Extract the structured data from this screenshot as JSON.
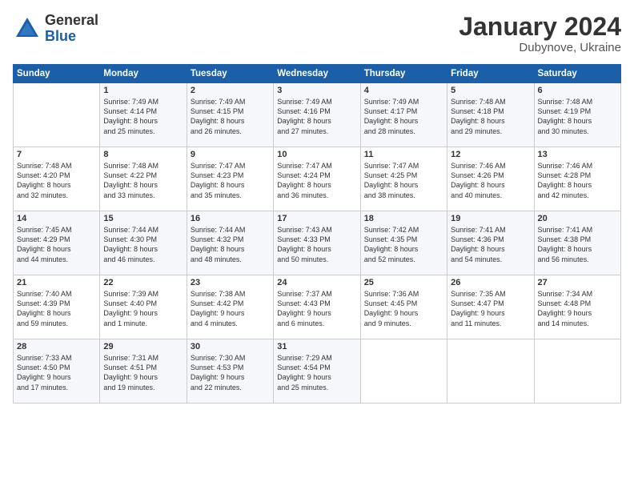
{
  "header": {
    "logo_general": "General",
    "logo_blue": "Blue",
    "month_title": "January 2024",
    "location": "Dubynove, Ukraine"
  },
  "weekdays": [
    "Sunday",
    "Monday",
    "Tuesday",
    "Wednesday",
    "Thursday",
    "Friday",
    "Saturday"
  ],
  "weeks": [
    [
      {
        "day": "",
        "info": ""
      },
      {
        "day": "1",
        "info": "Sunrise: 7:49 AM\nSunset: 4:14 PM\nDaylight: 8 hours\nand 25 minutes."
      },
      {
        "day": "2",
        "info": "Sunrise: 7:49 AM\nSunset: 4:15 PM\nDaylight: 8 hours\nand 26 minutes."
      },
      {
        "day": "3",
        "info": "Sunrise: 7:49 AM\nSunset: 4:16 PM\nDaylight: 8 hours\nand 27 minutes."
      },
      {
        "day": "4",
        "info": "Sunrise: 7:49 AM\nSunset: 4:17 PM\nDaylight: 8 hours\nand 28 minutes."
      },
      {
        "day": "5",
        "info": "Sunrise: 7:48 AM\nSunset: 4:18 PM\nDaylight: 8 hours\nand 29 minutes."
      },
      {
        "day": "6",
        "info": "Sunrise: 7:48 AM\nSunset: 4:19 PM\nDaylight: 8 hours\nand 30 minutes."
      }
    ],
    [
      {
        "day": "7",
        "info": "Sunrise: 7:48 AM\nSunset: 4:20 PM\nDaylight: 8 hours\nand 32 minutes."
      },
      {
        "day": "8",
        "info": "Sunrise: 7:48 AM\nSunset: 4:22 PM\nDaylight: 8 hours\nand 33 minutes."
      },
      {
        "day": "9",
        "info": "Sunrise: 7:47 AM\nSunset: 4:23 PM\nDaylight: 8 hours\nand 35 minutes."
      },
      {
        "day": "10",
        "info": "Sunrise: 7:47 AM\nSunset: 4:24 PM\nDaylight: 8 hours\nand 36 minutes."
      },
      {
        "day": "11",
        "info": "Sunrise: 7:47 AM\nSunset: 4:25 PM\nDaylight: 8 hours\nand 38 minutes."
      },
      {
        "day": "12",
        "info": "Sunrise: 7:46 AM\nSunset: 4:26 PM\nDaylight: 8 hours\nand 40 minutes."
      },
      {
        "day": "13",
        "info": "Sunrise: 7:46 AM\nSunset: 4:28 PM\nDaylight: 8 hours\nand 42 minutes."
      }
    ],
    [
      {
        "day": "14",
        "info": "Sunrise: 7:45 AM\nSunset: 4:29 PM\nDaylight: 8 hours\nand 44 minutes."
      },
      {
        "day": "15",
        "info": "Sunrise: 7:44 AM\nSunset: 4:30 PM\nDaylight: 8 hours\nand 46 minutes."
      },
      {
        "day": "16",
        "info": "Sunrise: 7:44 AM\nSunset: 4:32 PM\nDaylight: 8 hours\nand 48 minutes."
      },
      {
        "day": "17",
        "info": "Sunrise: 7:43 AM\nSunset: 4:33 PM\nDaylight: 8 hours\nand 50 minutes."
      },
      {
        "day": "18",
        "info": "Sunrise: 7:42 AM\nSunset: 4:35 PM\nDaylight: 8 hours\nand 52 minutes."
      },
      {
        "day": "19",
        "info": "Sunrise: 7:41 AM\nSunset: 4:36 PM\nDaylight: 8 hours\nand 54 minutes."
      },
      {
        "day": "20",
        "info": "Sunrise: 7:41 AM\nSunset: 4:38 PM\nDaylight: 8 hours\nand 56 minutes."
      }
    ],
    [
      {
        "day": "21",
        "info": "Sunrise: 7:40 AM\nSunset: 4:39 PM\nDaylight: 8 hours\nand 59 minutes."
      },
      {
        "day": "22",
        "info": "Sunrise: 7:39 AM\nSunset: 4:40 PM\nDaylight: 9 hours\nand 1 minute."
      },
      {
        "day": "23",
        "info": "Sunrise: 7:38 AM\nSunset: 4:42 PM\nDaylight: 9 hours\nand 4 minutes."
      },
      {
        "day": "24",
        "info": "Sunrise: 7:37 AM\nSunset: 4:43 PM\nDaylight: 9 hours\nand 6 minutes."
      },
      {
        "day": "25",
        "info": "Sunrise: 7:36 AM\nSunset: 4:45 PM\nDaylight: 9 hours\nand 9 minutes."
      },
      {
        "day": "26",
        "info": "Sunrise: 7:35 AM\nSunset: 4:47 PM\nDaylight: 9 hours\nand 11 minutes."
      },
      {
        "day": "27",
        "info": "Sunrise: 7:34 AM\nSunset: 4:48 PM\nDaylight: 9 hours\nand 14 minutes."
      }
    ],
    [
      {
        "day": "28",
        "info": "Sunrise: 7:33 AM\nSunset: 4:50 PM\nDaylight: 9 hours\nand 17 minutes."
      },
      {
        "day": "29",
        "info": "Sunrise: 7:31 AM\nSunset: 4:51 PM\nDaylight: 9 hours\nand 19 minutes."
      },
      {
        "day": "30",
        "info": "Sunrise: 7:30 AM\nSunset: 4:53 PM\nDaylight: 9 hours\nand 22 minutes."
      },
      {
        "day": "31",
        "info": "Sunrise: 7:29 AM\nSunset: 4:54 PM\nDaylight: 9 hours\nand 25 minutes."
      },
      {
        "day": "",
        "info": ""
      },
      {
        "day": "",
        "info": ""
      },
      {
        "day": "",
        "info": ""
      }
    ]
  ]
}
